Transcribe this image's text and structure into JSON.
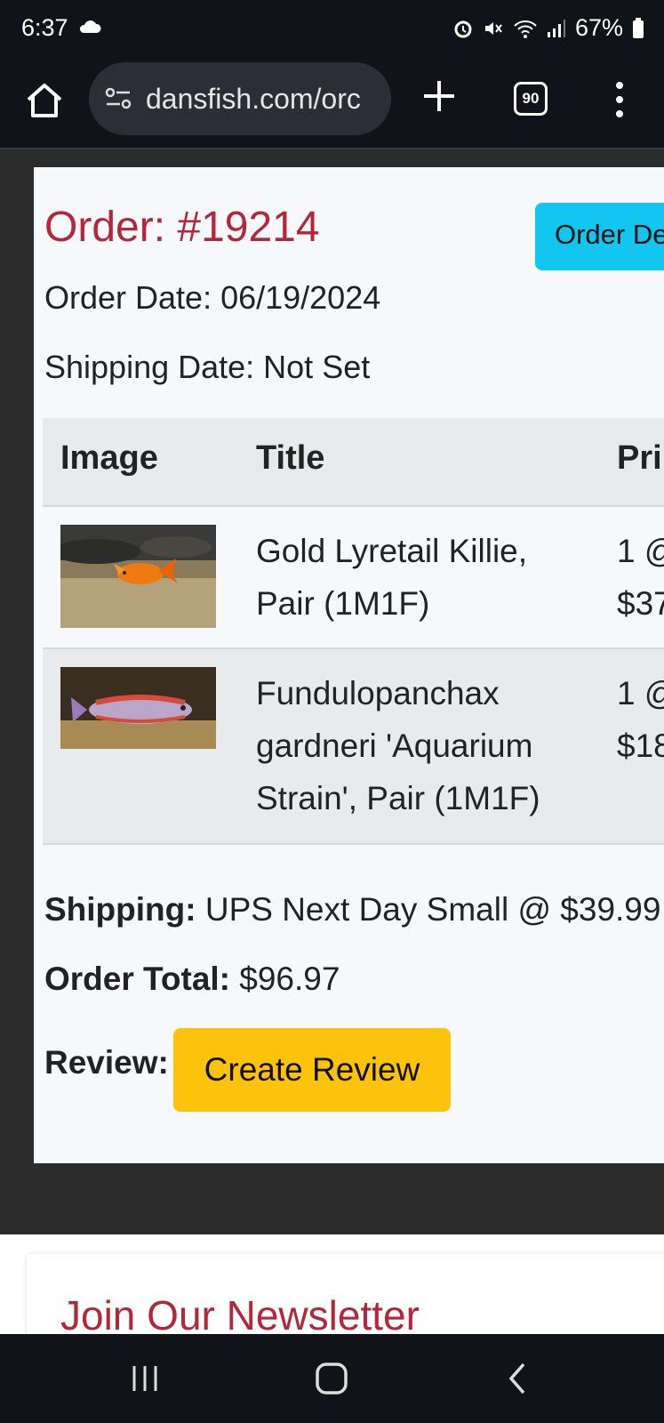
{
  "status_bar": {
    "time": "6:37",
    "battery": "67%"
  },
  "browser": {
    "url": "dansfish.com/orc",
    "tab_count": "90"
  },
  "order": {
    "title": "Order: #19214",
    "details_button": "Order De",
    "order_date": "Order Date: 06/19/2024",
    "shipping_date": "Shipping Date: Not Set"
  },
  "table": {
    "headers": {
      "image": "Image",
      "title": "Title",
      "price": "Pri"
    },
    "rows": [
      {
        "title": "Gold Lyretail Killie, Pair (1M1F)",
        "qty": "1 @",
        "price": "$37"
      },
      {
        "title": "Fundulopanchax gardneri 'Aquarium Strain', Pair (1M1F)",
        "qty": "1 @",
        "price": "$18"
      }
    ]
  },
  "summary": {
    "shipping_label": "Shipping:",
    "shipping_value": "UPS Next Day Small @ $39.99",
    "total_label": "Order Total:",
    "total_value": "$96.97",
    "review_label": "Review:",
    "review_button": "Create Review"
  },
  "newsletter": {
    "title": "Join Our Newsletter"
  },
  "colors": {
    "accent_red": "#b3263b",
    "button_cyan": "#12c6ef",
    "button_yellow": "#fdc30a"
  },
  "icons": [
    "cloud-icon",
    "alarm-icon",
    "mute-icon",
    "wifi-icon",
    "signal-icon",
    "battery-icon",
    "home-icon",
    "site-settings-icon",
    "plus-icon",
    "tabs-icon",
    "more-menu-icon",
    "recents-icon",
    "home-nav-icon",
    "back-icon"
  ]
}
